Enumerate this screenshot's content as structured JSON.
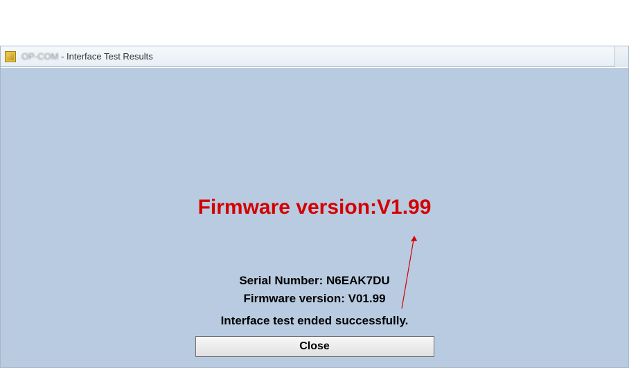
{
  "window": {
    "app_name": "OP-COM",
    "title_suffix": " - Interface Test Results"
  },
  "annotation": {
    "text": "Firmware version:V1.99"
  },
  "info": {
    "serial_label": "Serial Number: ",
    "serial_value": "N6EAK7DU",
    "firmware_label": "Firmware version: ",
    "firmware_value": "V01.99",
    "status_message": "Interface test ended successfully."
  },
  "buttons": {
    "close_label": "Close"
  }
}
